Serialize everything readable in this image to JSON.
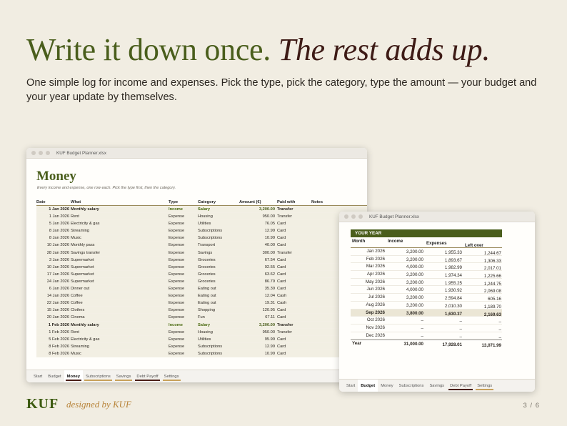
{
  "headline": {
    "part1": "Write it down once.",
    "part2": "The rest adds up."
  },
  "subtext": "One simple log for income and expenses. Pick the type, pick the category, type the amount — your budget and your year update by themselves.",
  "money_window": {
    "title": "KUF Budget Planner.xlsx",
    "sheet_title": "Money",
    "sheet_subtitle": "Every income and expense, one row each. Pick the type first, then the category.",
    "columns": {
      "date": "Date",
      "what": "What",
      "type": "Type",
      "category": "Category",
      "amount": "Amount (€)",
      "paid": "Paid with",
      "notes": "Notes"
    },
    "rows": [
      {
        "date": "1 Jan 2026",
        "what": "Monthly salary",
        "type": "Income",
        "category": "Salary",
        "amount": "3,200.00",
        "paid": "Transfer"
      },
      {
        "date": "1 Jan 2026",
        "what": "Rent",
        "type": "Expense",
        "category": "Housing",
        "amount": "950.00",
        "paid": "Transfer"
      },
      {
        "date": "5 Jan 2026",
        "what": "Electricity & gas",
        "type": "Expense",
        "category": "Utilities",
        "amount": "76.05",
        "paid": "Card"
      },
      {
        "date": "8 Jan 2026",
        "what": "Streaming",
        "type": "Expense",
        "category": "Subscriptions",
        "amount": "12.99",
        "paid": "Card"
      },
      {
        "date": "8 Jan 2026",
        "what": "Music",
        "type": "Expense",
        "category": "Subscriptions",
        "amount": "10.99",
        "paid": "Card"
      },
      {
        "date": "10 Jan 2026",
        "what": "Monthly pass",
        "type": "Expense",
        "category": "Transport",
        "amount": "40.00",
        "paid": "Card"
      },
      {
        "date": "28 Jan 2026",
        "what": "Savings transfer",
        "type": "Expense",
        "category": "Savings",
        "amount": "300.00",
        "paid": "Transfer"
      },
      {
        "date": "3 Jan 2026",
        "what": "Supermarket",
        "type": "Expense",
        "category": "Groceries",
        "amount": "67.54",
        "paid": "Card"
      },
      {
        "date": "10 Jan 2026",
        "what": "Supermarket",
        "type": "Expense",
        "category": "Groceries",
        "amount": "92.55",
        "paid": "Card"
      },
      {
        "date": "17 Jan 2026",
        "what": "Supermarket",
        "type": "Expense",
        "category": "Groceries",
        "amount": "63.62",
        "paid": "Card"
      },
      {
        "date": "24 Jan 2026",
        "what": "Supermarket",
        "type": "Expense",
        "category": "Groceries",
        "amount": "86.79",
        "paid": "Card"
      },
      {
        "date": "6 Jan 2026",
        "what": "Dinner out",
        "type": "Expense",
        "category": "Eating out",
        "amount": "35.39",
        "paid": "Card"
      },
      {
        "date": "14 Jan 2026",
        "what": "Coffee",
        "type": "Expense",
        "category": "Eating out",
        "amount": "12.04",
        "paid": "Cash"
      },
      {
        "date": "22 Jan 2026",
        "what": "Coffee",
        "type": "Expense",
        "category": "Eating out",
        "amount": "19.31",
        "paid": "Cash"
      },
      {
        "date": "15 Jan 2026",
        "what": "Clothes",
        "type": "Expense",
        "category": "Shopping",
        "amount": "120.95",
        "paid": "Card"
      },
      {
        "date": "20 Jan 2026",
        "what": "Cinema",
        "type": "Expense",
        "category": "Fun",
        "amount": "67.11",
        "paid": "Card"
      },
      {
        "date": "1 Feb 2026",
        "what": "Monthly salary",
        "type": "Income",
        "category": "Salary",
        "amount": "3,200.00",
        "paid": "Transfer"
      },
      {
        "date": "1 Feb 2026",
        "what": "Rent",
        "type": "Expense",
        "category": "Housing",
        "amount": "950.00",
        "paid": "Transfer"
      },
      {
        "date": "5 Feb 2026",
        "what": "Electricity & gas",
        "type": "Expense",
        "category": "Utilities",
        "amount": "95.99",
        "paid": "Card"
      },
      {
        "date": "8 Feb 2026",
        "what": "Streaming",
        "type": "Expense",
        "category": "Subscriptions",
        "amount": "12.99",
        "paid": "Card"
      },
      {
        "date": "8 Feb 2026",
        "what": "Music",
        "type": "Expense",
        "category": "Subscriptions",
        "amount": "10.99",
        "paid": "Card"
      }
    ],
    "tabs": [
      "Start",
      "Budget",
      "Money",
      "Subscriptions",
      "Savings",
      "Debt Payoff",
      "Settings"
    ],
    "active_tab": "Money"
  },
  "year_window": {
    "title": "KUF Budget Planner.xlsx",
    "section_title": "YOUR YEAR",
    "columns": {
      "month": "Month",
      "income": "Income",
      "expenses": "Expenses",
      "left": "Left over"
    },
    "rows": [
      {
        "month": "Jan 2026",
        "income": "3,200.00",
        "expenses": "1,955.33",
        "left": "1,244.67"
      },
      {
        "month": "Feb 2026",
        "income": "3,200.00",
        "expenses": "1,893.67",
        "left": "1,306.33"
      },
      {
        "month": "Mar 2026",
        "income": "4,000.00",
        "expenses": "1,982.99",
        "left": "2,017.01"
      },
      {
        "month": "Apr 2026",
        "income": "3,200.00",
        "expenses": "1,974.34",
        "left": "1,225.66"
      },
      {
        "month": "May 2026",
        "income": "3,200.00",
        "expenses": "1,955.25",
        "left": "1,244.75"
      },
      {
        "month": "Jun 2026",
        "income": "4,000.00",
        "expenses": "1,930.92",
        "left": "2,069.08"
      },
      {
        "month": "Jul 2026",
        "income": "3,200.00",
        "expenses": "2,594.84",
        "left": "605.16"
      },
      {
        "month": "Aug 2026",
        "income": "3,200.00",
        "expenses": "2,010.30",
        "left": "1,189.70"
      },
      {
        "month": "Sep 2026",
        "income": "3,800.00",
        "expenses": "1,630.37",
        "left": "2,169.63"
      },
      {
        "month": "Oct 2026",
        "income": "–",
        "expenses": "–",
        "left": "–"
      },
      {
        "month": "Nov 2026",
        "income": "–",
        "expenses": "–",
        "left": "–"
      },
      {
        "month": "Dec 2026",
        "income": "–",
        "expenses": "–",
        "left": "–"
      }
    ],
    "highlight_month": "Sep 2026",
    "total": {
      "label": "Year",
      "income": "31,000.00",
      "expenses": "17,928.01",
      "left": "13,071.99"
    },
    "tabs": [
      "Start",
      "Budget",
      "Money",
      "Subscriptions",
      "Savings",
      "Debt Payoff",
      "Settings"
    ],
    "active_tab": "Budget"
  },
  "footer": {
    "brand": "KUF",
    "byline": "designed by KUF",
    "pager": "3 / 6"
  },
  "colors": {
    "accent_green": "#4a5e1c",
    "accent_maroon": "#3e1b16",
    "gold": "#b8843a",
    "background": "#f1ede2"
  }
}
